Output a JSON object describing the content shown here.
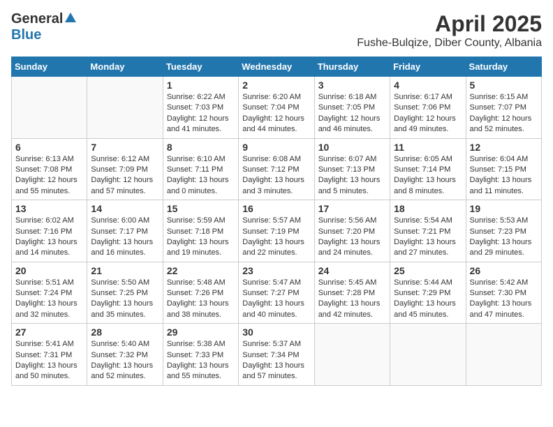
{
  "logo": {
    "general": "General",
    "blue": "Blue"
  },
  "title": "April 2025",
  "subtitle": "Fushe-Bulqize, Diber County, Albania",
  "days_header": [
    "Sunday",
    "Monday",
    "Tuesday",
    "Wednesday",
    "Thursday",
    "Friday",
    "Saturday"
  ],
  "weeks": [
    [
      {
        "day": "",
        "info": ""
      },
      {
        "day": "",
        "info": ""
      },
      {
        "day": "1",
        "info": "Sunrise: 6:22 AM\nSunset: 7:03 PM\nDaylight: 12 hours and 41 minutes."
      },
      {
        "day": "2",
        "info": "Sunrise: 6:20 AM\nSunset: 7:04 PM\nDaylight: 12 hours and 44 minutes."
      },
      {
        "day": "3",
        "info": "Sunrise: 6:18 AM\nSunset: 7:05 PM\nDaylight: 12 hours and 46 minutes."
      },
      {
        "day": "4",
        "info": "Sunrise: 6:17 AM\nSunset: 7:06 PM\nDaylight: 12 hours and 49 minutes."
      },
      {
        "day": "5",
        "info": "Sunrise: 6:15 AM\nSunset: 7:07 PM\nDaylight: 12 hours and 52 minutes."
      }
    ],
    [
      {
        "day": "6",
        "info": "Sunrise: 6:13 AM\nSunset: 7:08 PM\nDaylight: 12 hours and 55 minutes."
      },
      {
        "day": "7",
        "info": "Sunrise: 6:12 AM\nSunset: 7:09 PM\nDaylight: 12 hours and 57 minutes."
      },
      {
        "day": "8",
        "info": "Sunrise: 6:10 AM\nSunset: 7:11 PM\nDaylight: 13 hours and 0 minutes."
      },
      {
        "day": "9",
        "info": "Sunrise: 6:08 AM\nSunset: 7:12 PM\nDaylight: 13 hours and 3 minutes."
      },
      {
        "day": "10",
        "info": "Sunrise: 6:07 AM\nSunset: 7:13 PM\nDaylight: 13 hours and 5 minutes."
      },
      {
        "day": "11",
        "info": "Sunrise: 6:05 AM\nSunset: 7:14 PM\nDaylight: 13 hours and 8 minutes."
      },
      {
        "day": "12",
        "info": "Sunrise: 6:04 AM\nSunset: 7:15 PM\nDaylight: 13 hours and 11 minutes."
      }
    ],
    [
      {
        "day": "13",
        "info": "Sunrise: 6:02 AM\nSunset: 7:16 PM\nDaylight: 13 hours and 14 minutes."
      },
      {
        "day": "14",
        "info": "Sunrise: 6:00 AM\nSunset: 7:17 PM\nDaylight: 13 hours and 16 minutes."
      },
      {
        "day": "15",
        "info": "Sunrise: 5:59 AM\nSunset: 7:18 PM\nDaylight: 13 hours and 19 minutes."
      },
      {
        "day": "16",
        "info": "Sunrise: 5:57 AM\nSunset: 7:19 PM\nDaylight: 13 hours and 22 minutes."
      },
      {
        "day": "17",
        "info": "Sunrise: 5:56 AM\nSunset: 7:20 PM\nDaylight: 13 hours and 24 minutes."
      },
      {
        "day": "18",
        "info": "Sunrise: 5:54 AM\nSunset: 7:21 PM\nDaylight: 13 hours and 27 minutes."
      },
      {
        "day": "19",
        "info": "Sunrise: 5:53 AM\nSunset: 7:23 PM\nDaylight: 13 hours and 29 minutes."
      }
    ],
    [
      {
        "day": "20",
        "info": "Sunrise: 5:51 AM\nSunset: 7:24 PM\nDaylight: 13 hours and 32 minutes."
      },
      {
        "day": "21",
        "info": "Sunrise: 5:50 AM\nSunset: 7:25 PM\nDaylight: 13 hours and 35 minutes."
      },
      {
        "day": "22",
        "info": "Sunrise: 5:48 AM\nSunset: 7:26 PM\nDaylight: 13 hours and 38 minutes."
      },
      {
        "day": "23",
        "info": "Sunrise: 5:47 AM\nSunset: 7:27 PM\nDaylight: 13 hours and 40 minutes."
      },
      {
        "day": "24",
        "info": "Sunrise: 5:45 AM\nSunset: 7:28 PM\nDaylight: 13 hours and 42 minutes."
      },
      {
        "day": "25",
        "info": "Sunrise: 5:44 AM\nSunset: 7:29 PM\nDaylight: 13 hours and 45 minutes."
      },
      {
        "day": "26",
        "info": "Sunrise: 5:42 AM\nSunset: 7:30 PM\nDaylight: 13 hours and 47 minutes."
      }
    ],
    [
      {
        "day": "27",
        "info": "Sunrise: 5:41 AM\nSunset: 7:31 PM\nDaylight: 13 hours and 50 minutes."
      },
      {
        "day": "28",
        "info": "Sunrise: 5:40 AM\nSunset: 7:32 PM\nDaylight: 13 hours and 52 minutes."
      },
      {
        "day": "29",
        "info": "Sunrise: 5:38 AM\nSunset: 7:33 PM\nDaylight: 13 hours and 55 minutes."
      },
      {
        "day": "30",
        "info": "Sunrise: 5:37 AM\nSunset: 7:34 PM\nDaylight: 13 hours and 57 minutes."
      },
      {
        "day": "",
        "info": ""
      },
      {
        "day": "",
        "info": ""
      },
      {
        "day": "",
        "info": ""
      }
    ]
  ]
}
